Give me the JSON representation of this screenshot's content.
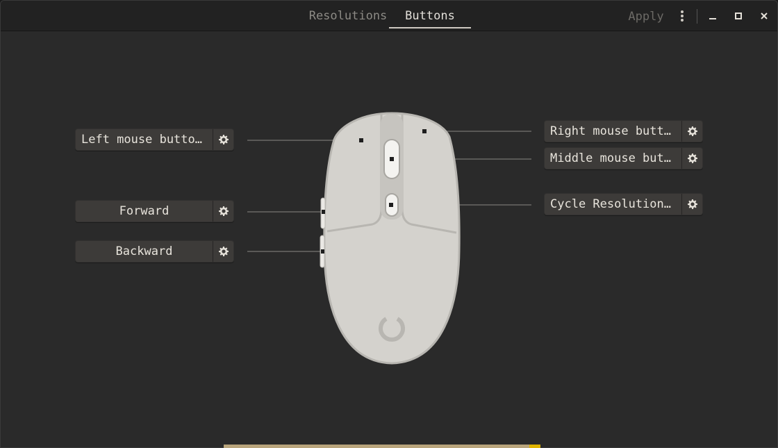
{
  "titlebar": {
    "tabs": [
      {
        "label": "Resolutions",
        "active": false
      },
      {
        "label": "Buttons",
        "active": true
      }
    ],
    "apply_label": "Apply",
    "icons": [
      "kebab-menu-icon",
      "minimize-icon",
      "maximize-icon",
      "close-icon"
    ]
  },
  "buttons": {
    "left": {
      "label": "Left mouse button …",
      "icon": "gear-icon"
    },
    "forward": {
      "label": "Forward",
      "icon": "gear-icon"
    },
    "backward": {
      "label": "Backward",
      "icon": "gear-icon"
    },
    "right": {
      "label": "Right mouse button…",
      "icon": "gear-icon"
    },
    "middle": {
      "label": "Middle mouse butto…",
      "icon": "gear-icon"
    },
    "cycle": {
      "label": "Cycle Resolution Up",
      "icon": "gear-icon"
    }
  },
  "colors": {
    "background": "#2a2a2a",
    "titlebar": "#222222",
    "pill": "#3d3b39",
    "text": "#e8e4dc",
    "mouse_body": "#d4d2cd",
    "mouse_edge": "#b8b6b1"
  }
}
